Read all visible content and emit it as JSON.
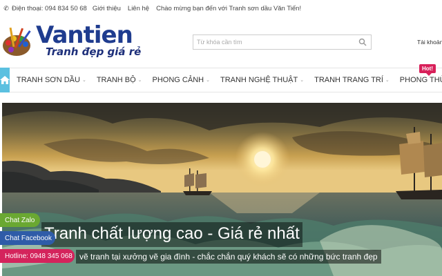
{
  "topbar": {
    "phone": "Điện thoại: 094 834 50 68",
    "links": [
      "Giới thiệu",
      "Liên hệ"
    ],
    "welcome": "Chào mừng bạn đến với Tranh sơn dầu Văn Tiến!"
  },
  "header": {
    "logo_brand_a": "Vantien",
    "logo_slogan": "Tranh đẹp giá rẻ",
    "search_placeholder": "Từ khóa cần tìm",
    "account": "Tài khoản"
  },
  "nav": {
    "items": [
      "TRANH SƠN DẦU",
      "TRANH BỘ",
      "PHONG CẢNH",
      "TRANH NGHỆ THUẬT",
      "TRANH TRANG TRÍ",
      "PHONG THỦY"
    ],
    "hot_badge": "Hot!"
  },
  "banner": {
    "title": "Tranh chất lượng cao - Giá rẻ nhất",
    "subtitle": "vẽ tranh tại xưởng vẽ gia đình - chắc chắn quý khách sẽ có những bức tranh đẹp"
  },
  "floating": {
    "chat_zalo": "Chat Zalo",
    "chat_facebook": "Chat Facebook",
    "hotline": "Hotline: 0948 345 068"
  },
  "colors": {
    "nav_home": "#5bc0e0",
    "brand_blue": "#1f3c8f",
    "brand_orange": "#f08a1c",
    "hot_badge": "#d8205a",
    "zalo": "#6aa832",
    "facebook": "#2f5ca8",
    "hotline": "#d4245c"
  }
}
